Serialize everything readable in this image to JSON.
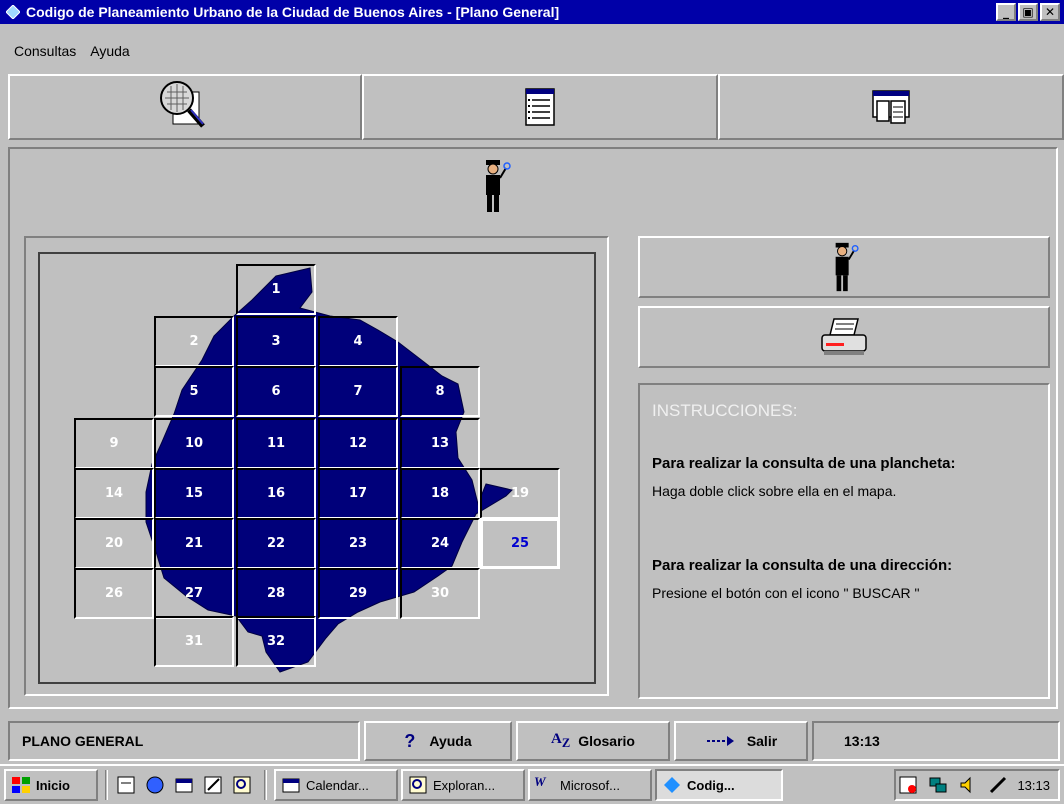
{
  "window": {
    "title": "Codigo de Planeamiento Urbano de la Ciudad de Buenos Aires - [Plano General]",
    "minimize": "_",
    "restore": "▣",
    "close": "✕"
  },
  "menu": {
    "consultas": "Consultas",
    "ayuda": "Ayuda"
  },
  "toolbar": {
    "icons": [
      "zoom-map-icon",
      "list-report-icon",
      "windows-icon"
    ]
  },
  "map": {
    "cells": [
      {
        "n": "1",
        "highlight": false
      },
      {
        "n": "2",
        "highlight": false
      },
      {
        "n": "3",
        "highlight": false
      },
      {
        "n": "4",
        "highlight": false
      },
      {
        "n": "5",
        "highlight": false
      },
      {
        "n": "6",
        "highlight": false
      },
      {
        "n": "7",
        "highlight": false
      },
      {
        "n": "8",
        "highlight": false
      },
      {
        "n": "9",
        "highlight": false
      },
      {
        "n": "10",
        "highlight": false
      },
      {
        "n": "11",
        "highlight": false
      },
      {
        "n": "12",
        "highlight": false
      },
      {
        "n": "13",
        "highlight": false
      },
      {
        "n": "14",
        "highlight": false
      },
      {
        "n": "15",
        "highlight": false
      },
      {
        "n": "16",
        "highlight": false
      },
      {
        "n": "17",
        "highlight": false
      },
      {
        "n": "18",
        "highlight": false
      },
      {
        "n": "19",
        "highlight": false
      },
      {
        "n": "20",
        "highlight": false
      },
      {
        "n": "21",
        "highlight": false
      },
      {
        "n": "22",
        "highlight": false
      },
      {
        "n": "23",
        "highlight": false
      },
      {
        "n": "24",
        "highlight": false
      },
      {
        "n": "25",
        "highlight": true
      },
      {
        "n": "26",
        "highlight": false
      },
      {
        "n": "27",
        "highlight": false
      },
      {
        "n": "28",
        "highlight": false
      },
      {
        "n": "29",
        "highlight": false
      },
      {
        "n": "30",
        "highlight": false
      },
      {
        "n": "31",
        "highlight": false
      },
      {
        "n": "32",
        "highlight": false
      }
    ],
    "land_color": "#00007a"
  },
  "instructions": {
    "heading": "INSTRUCCIONES:",
    "sec1_title": "Para realizar la consulta de una plancheta:",
    "sec1_text": "Haga doble click sobre ella en el mapa.",
    "sec2_title": "Para realizar la consulta de una dirección:",
    "sec2_text": "Presione el botón  con el icono \" BUSCAR \""
  },
  "status": {
    "view": "PLANO GENERAL",
    "help": "Ayuda",
    "glossary": "Glosario",
    "exit": "Salir",
    "time": "13:13"
  },
  "taskbar": {
    "start": "Inicio",
    "tasks": [
      "Calendar...",
      "Exploran...",
      "Microsof...",
      "Codig..."
    ],
    "clock": "13:13"
  }
}
